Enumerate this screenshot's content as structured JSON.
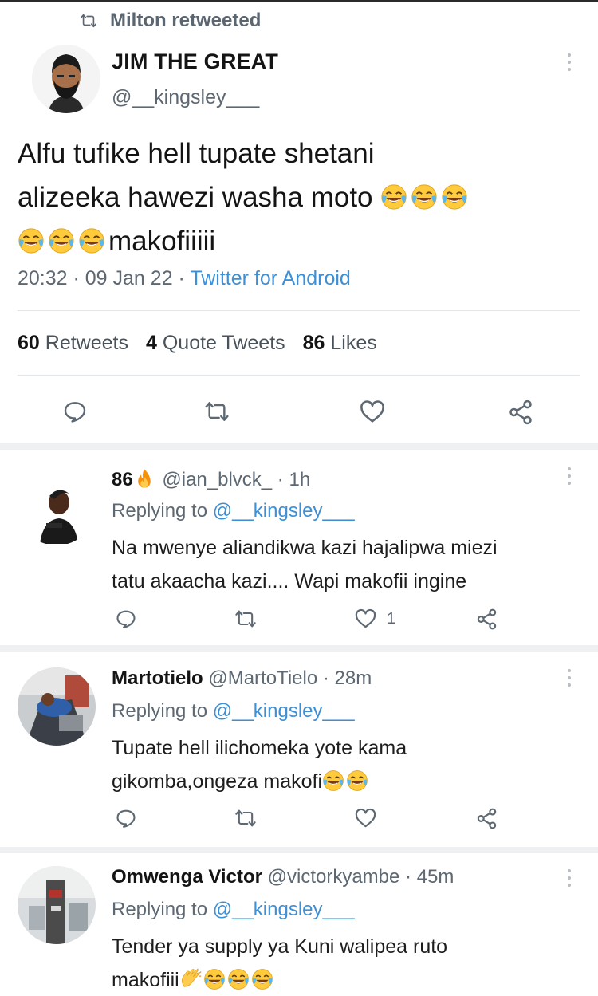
{
  "retweet_banner": {
    "label": "Milton retweeted",
    "icon": "retweet-icon"
  },
  "tweet": {
    "author_name": "JIM THE GREAT",
    "author_handle": "@__kingsley___",
    "text_line1": "Alfu tufike hell tupate shetani",
    "text_line2": "alizeeka hawezi washa moto",
    "text_line3_tail": "makofiiiii",
    "emoji": "face-with-tears-of-joy",
    "time": "20:32 · 09 Jan 22 · ",
    "source": "Twitter for Android",
    "stats": {
      "retweets_count": "60",
      "retweets_label": "Retweets",
      "quotes_count": "4",
      "quotes_label": "Quote Tweets",
      "likes_count": "86",
      "likes_label": "Likes"
    },
    "actions": [
      "reply-icon",
      "retweet-icon",
      "like-icon",
      "share-icon"
    ]
  },
  "replies": [
    {
      "name": "86",
      "name_emoji": "fire",
      "handle": "@ian_blvck_",
      "time": " · 1h",
      "replying_prefix": "Replying to ",
      "replying_to": "@__kingsley___",
      "line1": "Na mwenye aliandikwa kazi hajalipwa miezi",
      "line2": "tatu akaacha kazi.... Wapi makofii ingine",
      "like_count": "1"
    },
    {
      "name": "Martotielo",
      "handle": "@MartoTielo",
      "time": " · 28m",
      "replying_prefix": "Replying to ",
      "replying_to": "@__kingsley___",
      "line1": "Tupate hell ilichomeka yote kama",
      "line2": "gikomba,ongeza makofi",
      "like_count": ""
    },
    {
      "name": "Omwenga Victor",
      "handle": "@victorkyambe",
      "time": " · 45m",
      "replying_prefix": "Replying to ",
      "replying_to": "@__kingsley___",
      "line1": "Tender ya supply ya Kuni walipea ruto",
      "line2": "makofiii",
      "line2_emoji": "clapping-hands",
      "like_count": ""
    }
  ],
  "colors": {
    "link": "#3d8fd6",
    "muted": "#5d6872",
    "divider": "#e3e6e8"
  }
}
